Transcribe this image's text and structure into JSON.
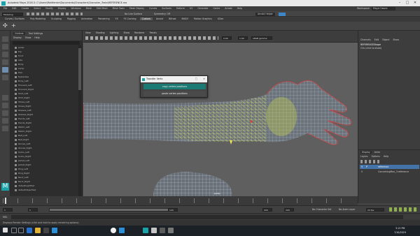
{
  "window": {
    "title": "Autodesk Maya 2018.3: C:\\Users\\Mattfenter\\Documents\\Characters\\Character_Tests\\REFERENCE.ma",
    "minimize": "–",
    "maximize": "□",
    "close": "✕"
  },
  "menubar": [
    "File",
    "Edit",
    "Create",
    "Select",
    "Modify",
    "Display",
    "Windows",
    "Mesh",
    "Edit Mesh",
    "Mesh Tools",
    "Mesh Display",
    "Curves",
    "Surfaces",
    "Deform",
    "UV",
    "Generate",
    "Cache",
    "Arnold",
    "Help"
  ],
  "workspace": {
    "label": "Workspace:",
    "value": "Maya Classic"
  },
  "status": {
    "mode": "Modeling",
    "symmetry": "Symmetry: Off",
    "live_surface": "No Live Surface",
    "sign_in": "Arnold Helper"
  },
  "shelf_tabs": [
    "Curves / Surfaces",
    "Poly Modeling",
    "Sculpting",
    "Rigging",
    "Animation",
    "Rendering",
    "FX",
    "FX Caching",
    "Custom",
    "Arnold",
    "Bifrost",
    "MASH",
    "Motion Graphics",
    "XGen"
  ],
  "shelf_active": "Custom",
  "outliner": {
    "tabs": [
      "Outliner",
      "Tool Settings"
    ],
    "menus": [
      "Display",
      "Show",
      "Help"
    ],
    "items": [
      "persp",
      "top",
      "front",
      "side",
      "Body",
      "Lamp",
      "Hair",
      "Eyelashes",
      "Body_Left",
      "Trousers_Left",
      "Trousers_Right",
      "Shirt_Left",
      "Shirt_Right",
      "Shoes_Left",
      "Shoes_Right",
      "Glasses_Left",
      "Glasses_Right",
      "Hands_Left",
      "Hands_Right",
      "Watch_Left",
      "Watch_Right",
      "Belt_Left",
      "Belt_Right",
      "Gloves_Left",
      "Gloves_Right",
      "Socks_Left",
      "Socks_Right",
      "Jacket_Left",
      "Jacket_Right",
      "Ring_Left",
      "Ring_Right",
      "Neck_Left",
      "Neck_Right",
      "defaultLightSet",
      "defaultObjectSet"
    ]
  },
  "viewport": {
    "menus": [
      "View",
      "Shading",
      "Lighting",
      "Show",
      "Renderer",
      "Panels"
    ],
    "exposure": "0.00",
    "gamma": "1.00",
    "color_space": "sRGB gamma",
    "label": "persp"
  },
  "dialog": {
    "title": "Transfer Verts",
    "copy_label": "copy vertex positions",
    "paste_label": "paste vertex positions",
    "close": "✕"
  },
  "channel_box": {
    "menus": [
      "Channels",
      "Edit",
      "Object",
      "Show"
    ],
    "object": "REFERENCEShape",
    "hint": "CVs (click to show)",
    "layer_tabs": [
      "Display",
      "Anim"
    ],
    "layer_menus": [
      "Layers",
      "Options",
      "Help"
    ],
    "layers": [
      {
        "v": "V",
        "p": "P",
        "name": "reference",
        "selected": true
      },
      {
        "v": "V",
        "p": "",
        "name": "ConvertingMax_3:reference",
        "selected": false
      }
    ]
  },
  "timeline": {
    "start": "1",
    "end": "120",
    "range_start": "1",
    "range_end": "120",
    "anim_end": "200",
    "anim_end2": "200",
    "fps": "24 fps",
    "char_set": "No Character Set",
    "anim_layer": "No Anim Layer"
  },
  "cmdline": {
    "label": "MEL"
  },
  "helpline": {
    "text": "Displays Render Settings (click and hold to apply rendering options)"
  },
  "taskbar": {
    "time": "3:13 PM",
    "date": "7/10/2019"
  },
  "colors": {
    "accent": "#1aa3a8",
    "dialog_btn": "#1b7a73",
    "selected_layer": "#4473a8"
  }
}
